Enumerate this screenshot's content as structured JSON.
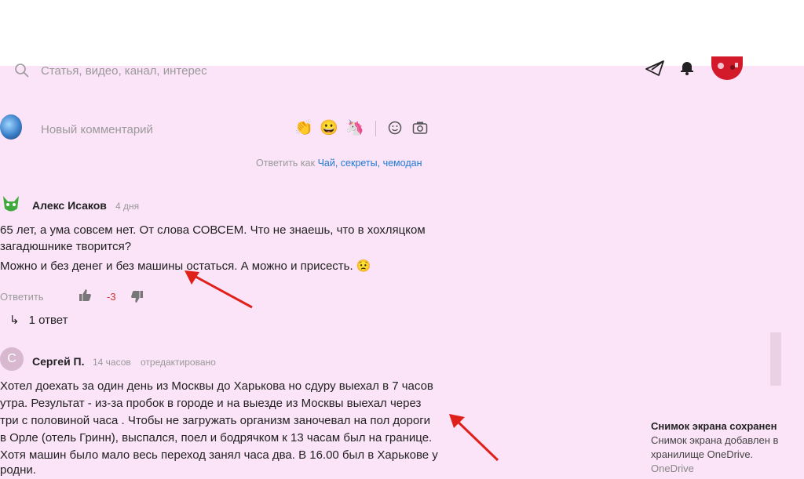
{
  "search": {
    "placeholder": "Статья, видео, канал, интерес"
  },
  "header_icons": [
    "send-icon",
    "bell-icon",
    "profile-avatar"
  ],
  "new_comment": {
    "placeholder": "Новый комментарий",
    "emojis": [
      "👏",
      "😀",
      "🦄"
    ],
    "tools": [
      "smile-icon",
      "camera-icon"
    ]
  },
  "reply_as": {
    "prefix": "Ответить как",
    "name": "Чай, секреты, чемодан"
  },
  "comments": [
    {
      "author": "Алекс Исаков",
      "time": "4 дня",
      "lines": [
        "65 лет, а ума совсем нет. От слова СОВСЕМ. Что не знаешь, что в хохляцком",
        "загадюшнике творится?",
        "Можно и без денег и без машины остаться. А можно и присесть. 😟"
      ],
      "reply_label": "Ответить",
      "score": "-3",
      "replies_label": "1 ответ"
    },
    {
      "author": "Сергей П.",
      "avatar_letter": "С",
      "time": "14 часов",
      "edited": "отредактировано",
      "lines": [
        "Хотел доехать за один день из Москвы до Харькова но сдуру выехал в 7 часов",
        "утра. Результат - из-за пробок в городе и на выезде из Москвы выехал через",
        "три с половиной часа . Чтобы не загружать организм заночевал на пол дороги",
        "в Орле (отель Гринн), выспался, поел и бодрячком к 13 часам был на границе.",
        "Хотя машин было мало весь переход занял часа два. В 16.00 был в Харькове у",
        "родни."
      ]
    }
  ],
  "toast": {
    "title": "Снимок экрана сохранен",
    "body": "Снимок экрана добавлен в хранилище OneDrive.",
    "cut": "OneDrive"
  },
  "colors": {
    "background": "#fbe3f8",
    "link": "#1f7bd6",
    "negative": "#d0342c",
    "arrow": "#e0201b"
  }
}
